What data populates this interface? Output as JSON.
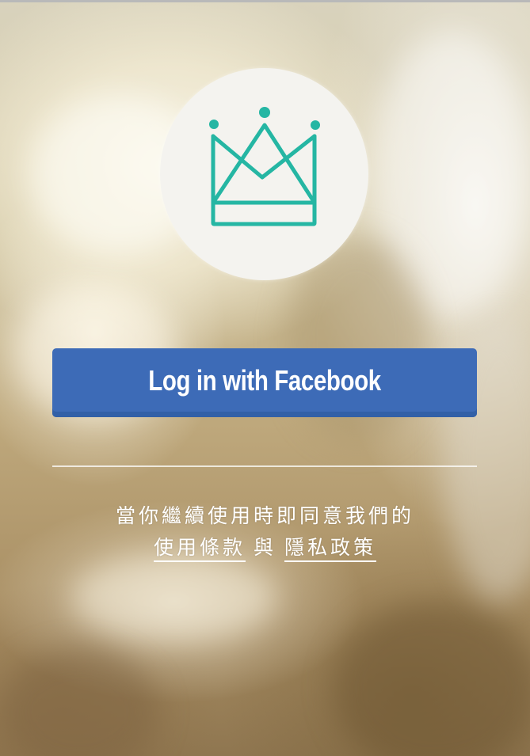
{
  "app": {
    "logo_icon": "crown-icon",
    "accent_color": "#25b6a3",
    "logo_background": "#f4f3ef"
  },
  "login": {
    "facebook_button_label": "Log in with Facebook",
    "facebook_color": "#3d6bb7"
  },
  "terms": {
    "notice": "當你繼續使用時即同意我們的",
    "terms_link": "使用條款",
    "conjunction": "與",
    "privacy_link": "隱私政策"
  }
}
